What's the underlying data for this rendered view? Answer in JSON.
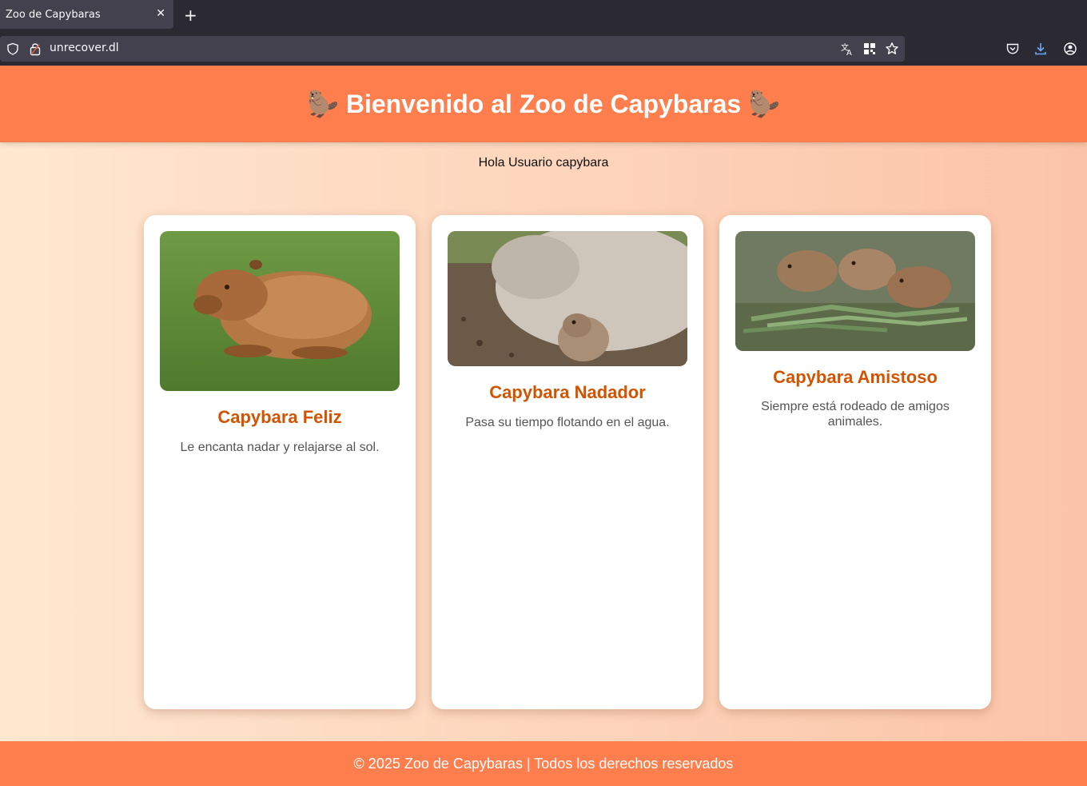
{
  "browser": {
    "tab_title": "Zoo de Capybaras",
    "tab_close": "✕",
    "new_tab": "+",
    "url": "unrecover.dl"
  },
  "header": {
    "title": "🦫 Bienvenido al Zoo de Capybaras 🦫"
  },
  "greeting": "Hola Usuario capybara",
  "cards": [
    {
      "name": "Capybara Feliz",
      "description": "Le encanta nadar y relajarse al sol."
    },
    {
      "name": "Capybara Nadador",
      "description": "Pasa su tiempo flotando en el agua."
    },
    {
      "name": "Capybara Amistoso",
      "description": "Siempre está rodeado de amigos animales."
    }
  ],
  "footer": {
    "text": "© 2025 Zoo de Capybaras | Todos los derechos reservados"
  },
  "colors": {
    "header_bg": "#ff7e4d",
    "card_title": "#d35400",
    "browser_bg": "#2b2a33"
  },
  "icons": {
    "urlbar": [
      "shield-icon",
      "lock-icon",
      "translate-icon",
      "qr-code-icon",
      "bookmark-star-icon"
    ],
    "toolbar": [
      "pocket-icon",
      "download-icon",
      "account-icon"
    ]
  }
}
